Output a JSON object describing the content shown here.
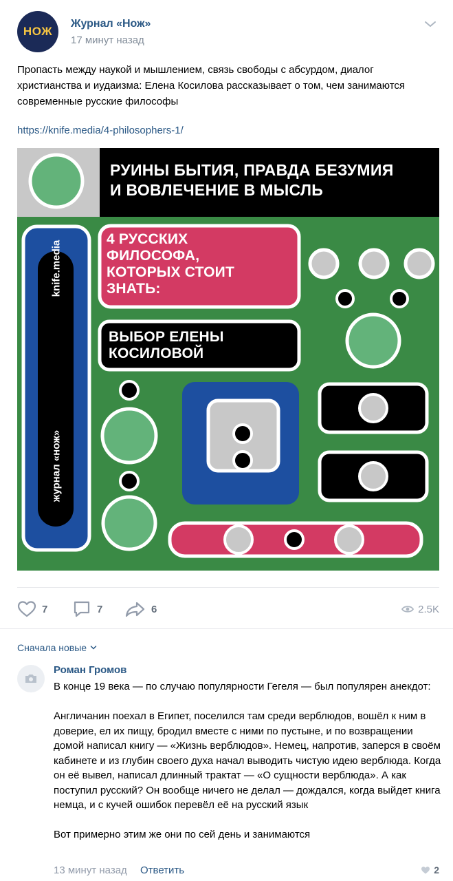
{
  "post": {
    "author": "Журнал «Нож»",
    "avatar_text": "НОЖ",
    "time": "17 минут назад",
    "text": "Пропасть между наукой и мышлением, связь свободы с абсурдом, диалог христианства и иудаизма: Елена Косилова рассказывает о том, чем занимаются современные русские философы",
    "link": "https://knife.media/4-philosophers-1/",
    "menu_icon": "chevron-down-icon"
  },
  "poster": {
    "title_line1": "РУИНЫ БЫТИЯ, ПРАВДА БЕЗУМИЯ",
    "title_line2": "И ВОВЛЕЧЕНИЕ В МЫСЛЬ",
    "pink_line1": "4 РУССКИХ",
    "pink_line2": "ФИЛОСОФА,",
    "pink_line3": "КОТОРЫХ СТОИТ",
    "pink_line4": "ЗНАТЬ:",
    "black_line1": "ВЫБОР ЕЛЕНЫ",
    "black_line2": "КОСИЛОВОЙ",
    "vertical_top": "knife.media",
    "vertical_bottom": "журнал «нож»",
    "colors": {
      "green": "#3a8a45",
      "blue": "#1d4fa0",
      "pink": "#d33a63",
      "black": "#000000",
      "light_green": "#63b37a",
      "gray": "#c8c8c8"
    }
  },
  "actions": {
    "likes": "7",
    "comments": "7",
    "shares": "6",
    "views": "2.5K",
    "like_icon": "heart-icon",
    "comment_icon": "comment-icon",
    "share_icon": "share-icon",
    "views_icon": "eye-icon"
  },
  "comments": {
    "sort_label": "Сначала новые",
    "items": [
      {
        "author": "Роман Громов",
        "text": "В конце 19 века — по случаю популярности Гегеля — был популярен анекдот:\n\nАнгличанин поехал в Египет, поселился там среди верблюдов, вошёл к ним в доверие, ел их пищу, бродил вместе с ними по пустыне, и по возвращении домой написал книгу — «Жизнь верблюдов». Немец, напротив, заперся в своём кабинете и из глубин своего духа начал выводить чистую идею верблюда. Когда он её вывел, написал длинный трактат — «О сущности верблюда». А как поступил русский? Он вообще ничего не делал — дождался, когда выйдет книга немца, и с кучей ошибок перевёл её на русский язык\n\nВот примерно этим же они по сей день и занимаются",
        "time": "13 минут назад",
        "reply_label": "Ответить",
        "likes": "2"
      }
    ]
  }
}
